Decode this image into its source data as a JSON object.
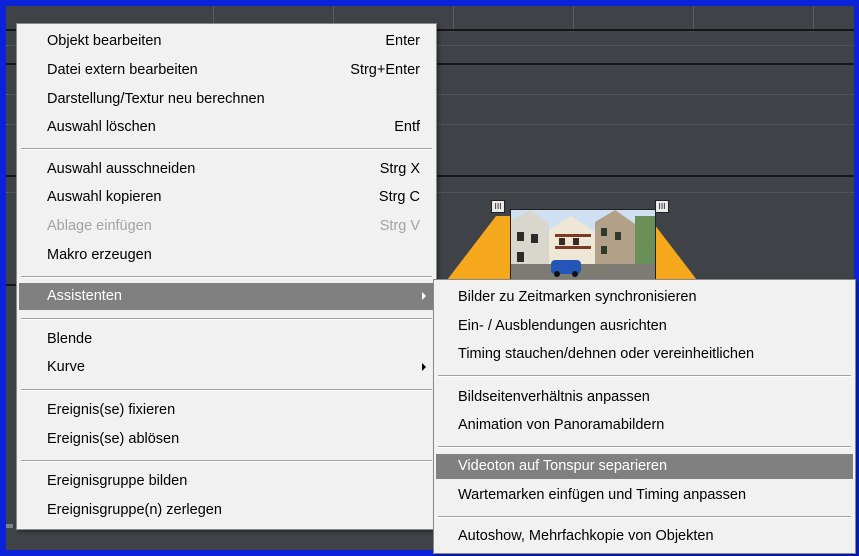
{
  "main_menu": {
    "items": [
      {
        "label": "Objekt bearbeiten",
        "shortcut": "Enter"
      },
      {
        "label": "Datei extern bearbeiten",
        "shortcut": "Strg+Enter"
      },
      {
        "label": "Darstellung/Textur neu berechnen",
        "shortcut": ""
      },
      {
        "label": "Auswahl löschen",
        "shortcut": "Entf"
      },
      {
        "label": "Auswahl ausschneiden",
        "shortcut": "Strg X"
      },
      {
        "label": "Auswahl kopieren",
        "shortcut": "Strg C"
      },
      {
        "label": "Ablage einfügen",
        "shortcut": "Strg V",
        "disabled": true
      },
      {
        "label": "Makro erzeugen",
        "shortcut": ""
      },
      {
        "label": "Assistenten",
        "submenu": true,
        "highlighted": true
      },
      {
        "label": "Blende",
        "shortcut": ""
      },
      {
        "label": "Kurve",
        "submenu": true
      },
      {
        "label": "Ereignis(se) fixieren",
        "shortcut": ""
      },
      {
        "label": "Ereignis(se) ablösen",
        "shortcut": ""
      },
      {
        "label": "Ereignisgruppe bilden",
        "shortcut": ""
      },
      {
        "label": "Ereignisgruppe(n) zerlegen",
        "shortcut": ""
      }
    ]
  },
  "submenu": {
    "items": [
      {
        "label": "Bilder zu Zeitmarken synchronisieren"
      },
      {
        "label": "Ein- / Ausblendungen ausrichten"
      },
      {
        "label": "Timing stauchen/dehnen oder vereinheitlichen"
      },
      {
        "label": "Bildseitenverhältnis anpassen"
      },
      {
        "label": "Animation von Panoramabildern"
      },
      {
        "label": "Videoton auf Tonspur separieren",
        "highlighted": true
      },
      {
        "label": "Wartemarken einfügen und Timing anpassen"
      },
      {
        "label": "Autoshow, Mehrfachkopie von Objekten"
      }
    ]
  },
  "timeline": {
    "markers": [
      "III",
      "III"
    ]
  },
  "colors": {
    "window_border": "#0a22d8",
    "timeline_bg": "#3f4247",
    "fade_ramp": "#f5a81c",
    "menu_bg": "#f1f1f1",
    "highlight": "#808080",
    "disabled_text": "#a3a3a3"
  }
}
